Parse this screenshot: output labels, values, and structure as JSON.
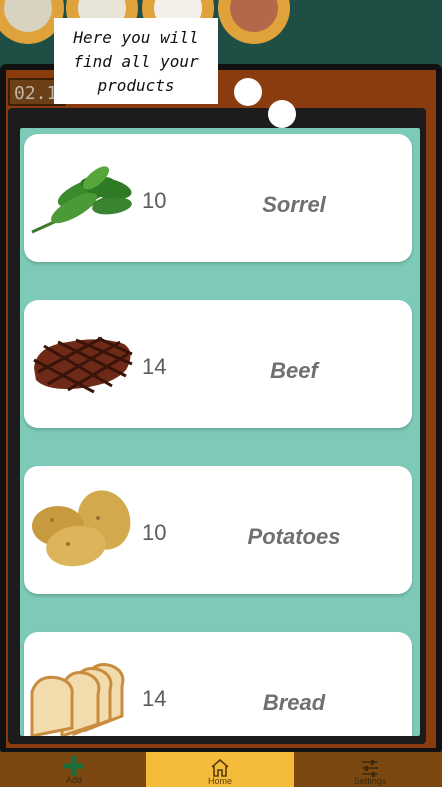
{
  "date_box": {
    "value": "02.1"
  },
  "tooltip": {
    "line1": "Here you will",
    "line2": "find all your",
    "line3": "products"
  },
  "products": [
    {
      "name": "Sorrel",
      "quantity": "10",
      "image": "sorrel-image"
    },
    {
      "name": "Beef",
      "quantity": "14",
      "image": "beef-image"
    },
    {
      "name": "Potatoes",
      "quantity": "10",
      "image": "potatoes-image"
    },
    {
      "name": "Bread",
      "quantity": "14",
      "image": "bread-image"
    }
  ],
  "nav": {
    "add_label": "Add",
    "home_label": "Home",
    "settings_label": "Settings",
    "active": "home"
  },
  "colors": {
    "background": "#1f4e45",
    "panel": "#8a3c0f",
    "list_bg": "#7ccab7",
    "nav_bg": "#7a4810",
    "nav_active": "#f5bc3c",
    "add_icon": "#1a6e3c"
  }
}
